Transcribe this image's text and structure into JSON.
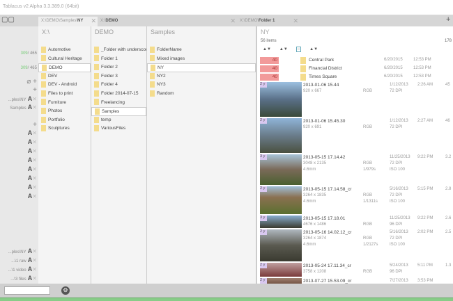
{
  "window": {
    "title": "Tablacus v2 Alpha 3.3.389.0 (64bit)"
  },
  "tabs": [
    {
      "prefix": "X:\\DEMO\\Samples\\",
      "name": "NY",
      "active": true
    },
    {
      "prefix": "X:\\",
      "name": "DEMO",
      "active": false
    },
    {
      "prefix": "X:\\DEMO\\",
      "name": "Folder 1",
      "active": false
    }
  ],
  "sidebar": {
    "counts": [
      {
        "used": "309",
        "total": "/ 465"
      },
      {
        "used": "309",
        "total": "/ 465"
      }
    ],
    "top_items": [
      "...ples\\NY",
      "Samples"
    ],
    "bottom_items": [
      "...ples\\NY",
      "...\\1 raw",
      "...\\1 video",
      "...\\3 files"
    ]
  },
  "columns": [
    {
      "title": "X:\\",
      "items": [
        "Automotive",
        "Cultural Heritage",
        "DEMO",
        "DEV",
        "DEV - Android",
        "Files to print",
        "Furniture",
        "Photos",
        "Portfolio",
        "Sculptures"
      ],
      "selected": "DEMO"
    },
    {
      "title": "DEMO",
      "items": [
        "_Folder with underscore",
        "Folder 1",
        "Folder 2",
        "Folder 3",
        "Folder 4",
        "Folder 2014-07-15",
        "Freelancing",
        "Samples",
        "temp",
        "VariousFiles"
      ],
      "selected": "Samples"
    },
    {
      "title": "Samples",
      "items": [
        "FolderName",
        "Mixed images",
        "NY",
        "NY2",
        "NY3",
        "Random"
      ],
      "selected": "NY"
    }
  ],
  "main": {
    "title": "NY",
    "count": "56 items",
    "count_right": "178",
    "sort": [
      "▲▼",
      "▲▼",
      "▲▼"
    ],
    "folders": [
      {
        "badge": "40",
        "name": "Central Park",
        "date": "6/20/2015",
        "time": "12:53 PM"
      },
      {
        "badge": "40",
        "name": "Financial District",
        "date": "6/20/2015",
        "time": "12:53 PM"
      },
      {
        "badge": "40",
        "name": "Times Square",
        "date": "6/20/2015",
        "time": "12:53 PM"
      }
    ],
    "images": [
      {
        "age": "2 y",
        "name": "2013-01-06 15.44",
        "dims": "920 x 667",
        "mode": "RGB",
        "dpi": "72 DPI",
        "date": "1/12/2013",
        "time": "2:26 AM",
        "size": "45",
        "lens": "",
        "exp": "",
        "iso": ""
      },
      {
        "age": "2 y",
        "name": "2013-01-06 15.45.30",
        "dims": "920 x 691",
        "mode": "RGB",
        "dpi": "72 DPI",
        "date": "1/12/2013",
        "time": "2:27 AM",
        "size": "46",
        "lens": "",
        "exp": "",
        "iso": ""
      },
      {
        "age": "3 y",
        "name": "2013-05-15 17.14.42",
        "dims": "3048 x 2135",
        "mode": "RGB",
        "dpi": "72 DPI",
        "date": "11/25/2013",
        "time": "9:22 PM",
        "size": "3.2",
        "lens": "4.6mm",
        "exp": "1/979s",
        "iso": "ISO 100"
      },
      {
        "age": "2 y",
        "name": "2013-05-15 17.14.58_cr",
        "dims": "3264 x 1835",
        "mode": "RGB",
        "dpi": "72 DPI",
        "date": "5/16/2013",
        "time": "5:15 PM",
        "size": "2.8",
        "lens": "4.6mm",
        "exp": "1/1311s",
        "iso": "ISO 100"
      },
      {
        "age": "3 y",
        "name": "2013-05-15 17.18.01",
        "dims": "4676 x 1486",
        "mode": "RGB",
        "dpi": "96 DPI",
        "date": "11/25/2013",
        "time": "9:22 PM",
        "size": "2.6",
        "lens": "",
        "exp": "",
        "iso": ""
      },
      {
        "age": "2 y",
        "name": "2013-05-16 14.02.12_cr",
        "dims": "3264 x 1874",
        "mode": "RGB",
        "dpi": "72 DPI",
        "date": "5/16/2013",
        "time": "2:02 PM",
        "size": "2.5",
        "lens": "4.6mm",
        "exp": "1/2127s",
        "iso": "ISO 100"
      },
      {
        "age": "2 y",
        "name": "2013-05-24 17.11.34_cr",
        "dims": "3758 x 1208",
        "mode": "RGB",
        "dpi": "96 DPI",
        "date": "5/24/2013",
        "time": "5:11 PM",
        "size": "1.3",
        "lens": "",
        "exp": "",
        "iso": ""
      },
      {
        "age": "2 y",
        "name": "2013-07-27 15.53.09_cr",
        "dims": "",
        "mode": "",
        "dpi": "",
        "date": "7/27/2013",
        "time": "3:53 PM",
        "size": "",
        "lens": "",
        "exp": "",
        "iso": ""
      }
    ]
  },
  "status": {
    "search_value": ""
  },
  "colors": {
    "badge": "#f29a9a",
    "folder": "#f4dc8c",
    "age": "#d9c8f0",
    "accent": "#88cc88"
  }
}
